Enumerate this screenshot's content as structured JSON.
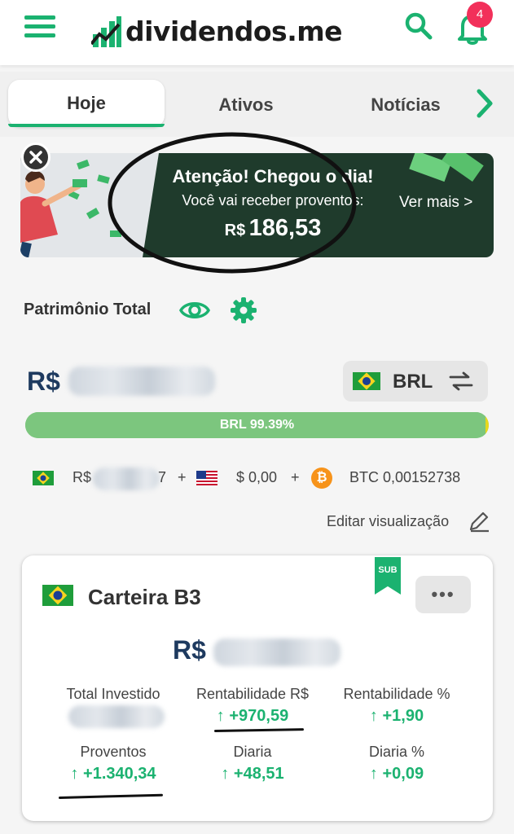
{
  "header": {
    "logo_text": "dividendos.me",
    "notification_count": "4",
    "icons": {
      "menu": "menu-icon",
      "search": "search-icon",
      "bell": "bell-icon"
    }
  },
  "tabs": [
    {
      "label": "Hoje",
      "active": true
    },
    {
      "label": "Ativos",
      "active": false
    },
    {
      "label": "Notícias",
      "active": false
    }
  ],
  "banner": {
    "title": "Atenção! Chegou o dia!",
    "subtitle": "Você vai receber proventos:",
    "amount_currency": "R$",
    "amount_value": "186,53",
    "see_more": "Ver mais >"
  },
  "portfolio": {
    "title": "Patrimônio Total",
    "currency_symbol": "R$",
    "currency_button": "BRL",
    "progress_label": "BRL 99.39%",
    "progress_percent": 99.39,
    "breakdown": {
      "brl_prefix": "R$",
      "brl_suffix": "7",
      "plus1": "+",
      "usd": "$ 0,00",
      "plus2": "+",
      "btc": "BTC 0,00152738"
    },
    "edit_view": "Editar visualização"
  },
  "card": {
    "title": "Carteira B3",
    "badge": "SUB",
    "more": "•••",
    "currency_symbol": "R$",
    "stats": [
      {
        "label": "Total Investido",
        "value": ""
      },
      {
        "label": "Rentabilidade R$",
        "value": "↑ +970,59"
      },
      {
        "label": "Rentabilidade %",
        "value": "↑ +1,90"
      },
      {
        "label": "Proventos",
        "value": "↑ +1.340,34"
      },
      {
        "label": "Diaria",
        "value": "↑ +48,51"
      },
      {
        "label": "Diaria %",
        "value": "↑ +0,09"
      }
    ]
  },
  "colors": {
    "accent": "#1bb270",
    "navy": "#1e3a5f",
    "banner_bg": "#1f3b2c",
    "badge": "#f2305a",
    "progress": "#7cc67e"
  }
}
